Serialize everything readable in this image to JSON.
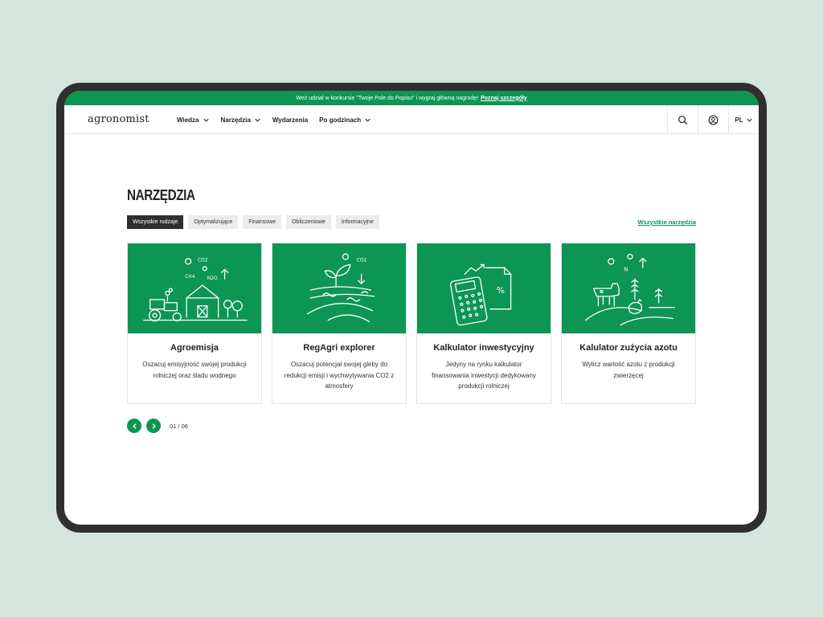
{
  "promo": {
    "text": "Weź udział w konkursie \"Twoje Pole do Popisu\" i wygraj główną nagrodę!",
    "link": "Poznaj szczegóły"
  },
  "header": {
    "logo": "agronomist",
    "menu": [
      {
        "label": "Wiedza",
        "dropdown": true
      },
      {
        "label": "Narzędzia",
        "dropdown": true
      },
      {
        "label": "Wydarzenia",
        "dropdown": false
      },
      {
        "label": "Po godzinach",
        "dropdown": true
      }
    ],
    "language": "PL"
  },
  "main": {
    "title": "NARZĘDZIA",
    "filters": [
      "Wszystkie rodzaje",
      "Optymalizujące",
      "Finansowe",
      "Obliczeniowe",
      "Informacyjne"
    ],
    "active_filter": "Wszystkie rodzaje",
    "all_tools_link": "Wszystkie narzędzia",
    "cards": [
      {
        "title": "Agroemisja",
        "description": "Oszacuj emisyjność swojej produkcji rolniczej oraz śladu wodnego",
        "illustration": "farm-emission-icon",
        "labels": [
          "CO2",
          "CH4",
          "N2O"
        ]
      },
      {
        "title": "RegAgri explorer",
        "description": "Oszacuj potencjał swojej gleby do redukcji emisji i wychwytywania CO2 z atmosfery",
        "illustration": "soil-plant-icon",
        "labels": [
          "CO2"
        ]
      },
      {
        "title": "Kalkulator inwestycyjny",
        "description": "Jedyny na rynku kalkulator finansowania inwestycji dedykowany produkcji rolniczej",
        "illustration": "calculator-icon",
        "labels": [
          "%"
        ]
      },
      {
        "title": "Kalulator zużycia azotu",
        "description": "Wylicz wartość azotu z produkcji zwierzęcej",
        "illustration": "livestock-nitrogen-icon",
        "labels": [
          "N"
        ]
      }
    ],
    "pagination": {
      "current": "01",
      "total": "06",
      "text": "01 / 06"
    }
  },
  "colors": {
    "brand_green": "#0d9554",
    "background": "#d3e5dc",
    "device": "#2f2f2f"
  }
}
